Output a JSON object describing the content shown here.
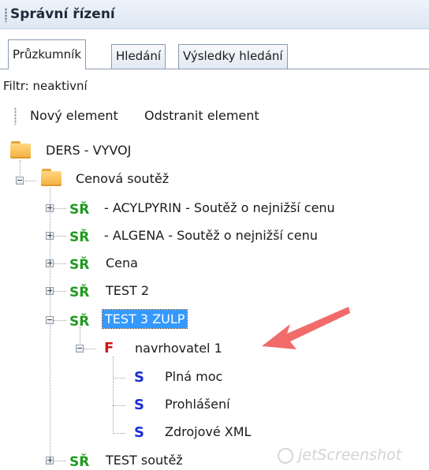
{
  "panel": {
    "title": "Správní řízení"
  },
  "tabs": [
    {
      "label": "Průzkumník",
      "active": true
    },
    {
      "label": "Hledání",
      "active": false
    },
    {
      "label": "Výsledky hledání",
      "active": false
    }
  ],
  "filter": {
    "text": "Filtr: neaktivní"
  },
  "toolbar": {
    "new_label": "Nový element",
    "remove_label": "Odstranit element"
  },
  "tree": {
    "root": {
      "label": "DERS - VYVOJ",
      "icon": "folder-icon"
    },
    "group": {
      "label": "Cenová soutěž",
      "icon": "folder-icon"
    },
    "sr_icon_text": "SŘ",
    "f_icon_text": "F",
    "s_icon_text": "S",
    "sr_items": [
      {
        "label": " - ACYLPYRIN - Soutěž o nejnižší cenu"
      },
      {
        "label": " - ALGENA - Soutěž o nejnižší cenu"
      },
      {
        "label": "Cena"
      },
      {
        "label": "TEST 2"
      },
      {
        "label": "TEST 3 ZULP",
        "selected": true
      },
      {
        "label": "TEST soutěž"
      }
    ],
    "f_item": {
      "label": "navrhovatel 1"
    },
    "s_items": [
      {
        "label": "Plná moc"
      },
      {
        "label": "Prohlášení"
      },
      {
        "label": "Zdrojové XML"
      }
    ]
  },
  "watermark": {
    "text": "jetScreenshot"
  },
  "colors": {
    "sr": "#1f9b1f",
    "f": "#d21414",
    "s": "#1a2fd6",
    "selection": "#3399ff",
    "arrow": "#f26b6b"
  }
}
